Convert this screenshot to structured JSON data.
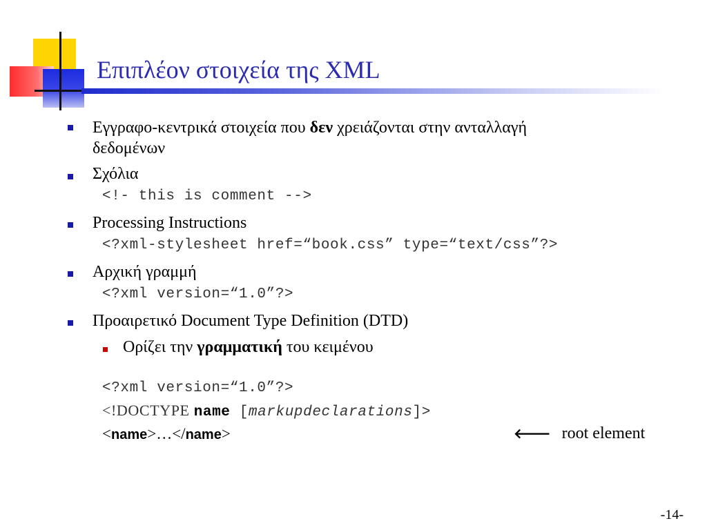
{
  "slide": {
    "title": "Επιπλέον στοιχεία της XML",
    "page_number": "-14-",
    "bullets": {
      "b1": {
        "pre": "Εγγραφο-κεντρικά στοιχεία που ",
        "bold": "δεν",
        "post": " χρειάζονται στην ανταλλαγή",
        "line2": "δεδομένων"
      },
      "b2": {
        "text": "Σχόλια",
        "code": "<!- this is comment -->"
      },
      "b3": {
        "text": "Processing Instructions",
        "code": "<?xml-stylesheet href=“book.css” type=“text/css”?>"
      },
      "b4": {
        "text": "Αρχική γραμμή",
        "code": "<?xml version=“1.0”?>"
      },
      "b5": {
        "text": "Προαιρετικό Document Type Definition (DTD)",
        "sub": {
          "pre": "Ορίζει την ",
          "bold": "γραμματική",
          "post": " του κειμένου"
        }
      }
    },
    "example": {
      "line1": "<?xml version=“1.0”?>",
      "line2_pre": "<!DOCTYPE ",
      "line2_name": "name",
      "line2_bracket_open": " [",
      "line2_italic": "markupdeclarations",
      "line2_end": "]>",
      "line3_lt": "<",
      "line3_name1": "name",
      "line3_mid": ">…</",
      "line3_name2": "name",
      "line3_gt": ">",
      "arrow": "🡐",
      "root_label": "root element"
    }
  }
}
